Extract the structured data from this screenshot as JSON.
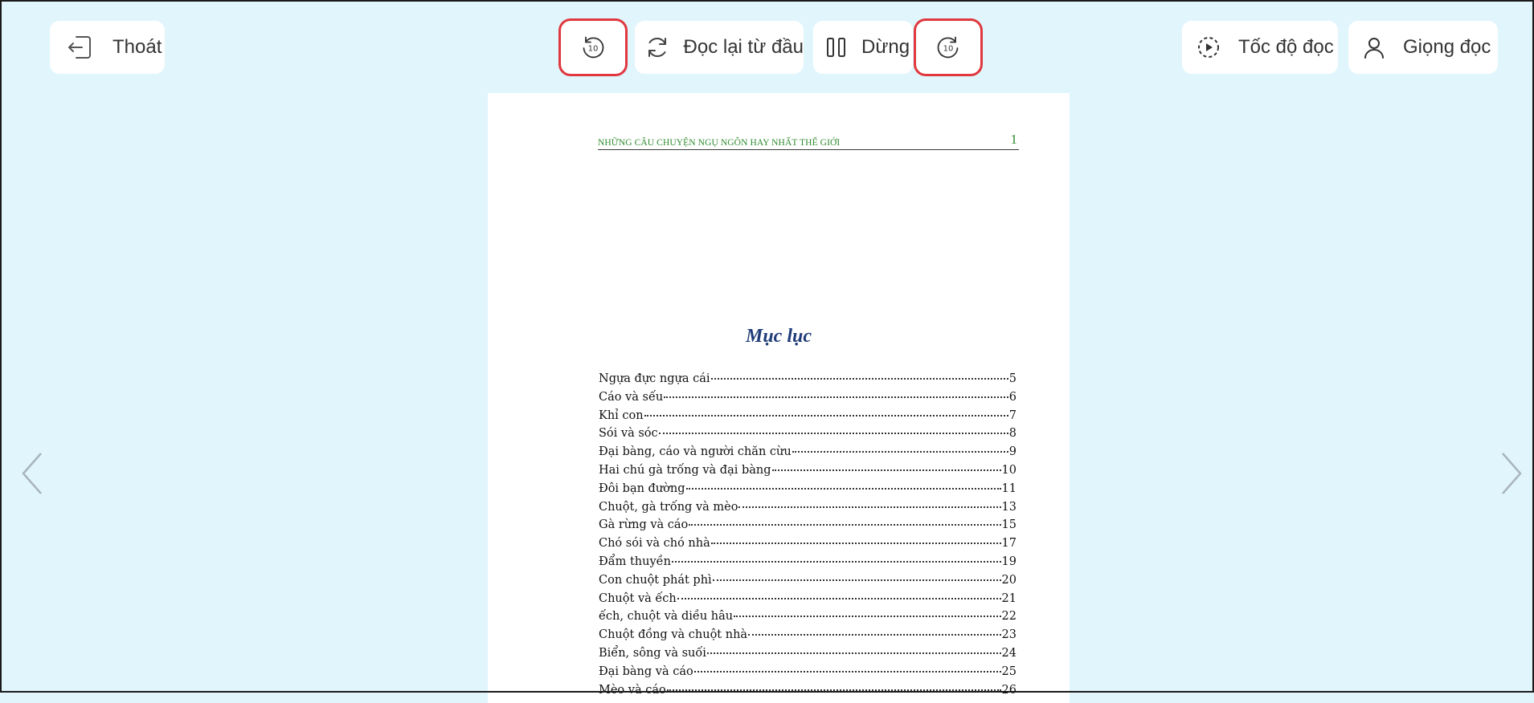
{
  "toolbar": {
    "exit_label": "Thoát",
    "restart_label": "Đọc lại từ đầu",
    "pause_label": "Dừng",
    "speed_label": "Tốc độ đọc",
    "voice_label": "Giọng đọc",
    "rewind_seconds": "10",
    "forward_seconds": "10"
  },
  "page": {
    "running_title": "NHỮNG CÂU CHUYỆN NGỤ NGÔN HAY NHẤT THẾ GIỚI",
    "page_number": "1",
    "toc_title": "Mục lục",
    "toc": [
      {
        "title": "Ngựa đực ngựa cái",
        "page": "5"
      },
      {
        "title": "Cáo và sếu",
        "page": "6"
      },
      {
        "title": "Khỉ con",
        "page": "7"
      },
      {
        "title": "Sói và sóc",
        "page": "8"
      },
      {
        "title": "Đại bàng, cáo và người chăn cừu",
        "page": "9"
      },
      {
        "title": "Hai chú gà trống và đại bàng",
        "page": "10"
      },
      {
        "title": "Đôi bạn đường",
        "page": "11"
      },
      {
        "title": "Chuột, gà trống và mèo",
        "page": "13"
      },
      {
        "title": "Gà rừng và cáo",
        "page": "15"
      },
      {
        "title": "Chó sói và chó nhà",
        "page": "17"
      },
      {
        "title": "Đẩm thuyền",
        "page": "19"
      },
      {
        "title": "Con chuột phát phì",
        "page": "20"
      },
      {
        "title": "Chuột và ếch",
        "page": "21"
      },
      {
        "title": "ếch, chuột và diều hâu",
        "page": "22"
      },
      {
        "title": "Chuột đồng và chuột nhà",
        "page": "23"
      },
      {
        "title": "Biển, sông và suối",
        "page": "24"
      },
      {
        "title": "Đại bàng và cáo",
        "page": "25"
      },
      {
        "title": "Mèo và cáo",
        "page": "26"
      }
    ]
  },
  "colors": {
    "background": "#e1f5fc",
    "highlight": "#e0383e",
    "running_head": "#2e8b2e",
    "toc_title": "#1f3c78"
  },
  "icons": [
    "logout-icon",
    "replay-10-icon",
    "refresh-icon",
    "pause-icon",
    "forward-10-icon",
    "speed-icon",
    "user-icon",
    "chevron-left-icon",
    "chevron-right-icon"
  ]
}
